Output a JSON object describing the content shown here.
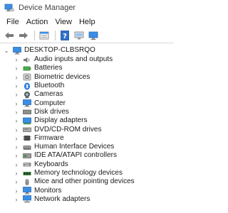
{
  "window": {
    "title": "Device Manager"
  },
  "menu": {
    "items": [
      "File",
      "Action",
      "View",
      "Help"
    ]
  },
  "toolbar": {
    "buttons": [
      "back-icon",
      "forward-icon",
      "properties-icon",
      "help-icon",
      "update-driver-icon",
      "monitor-icon"
    ]
  },
  "tree": {
    "root": {
      "label": "DESKTOP-CLBSRQO",
      "icon": "computer-icon"
    },
    "items": [
      {
        "label": "Audio inputs and outputs",
        "icon": "speaker-icon"
      },
      {
        "label": "Batteries",
        "icon": "battery-icon"
      },
      {
        "label": "Biometric devices",
        "icon": "biometric-icon"
      },
      {
        "label": "Bluetooth",
        "icon": "bluetooth-icon"
      },
      {
        "label": "Cameras",
        "icon": "camera-icon"
      },
      {
        "label": "Computer",
        "icon": "computer-icon"
      },
      {
        "label": "Disk drives",
        "icon": "disk-icon"
      },
      {
        "label": "Display adapters",
        "icon": "display-adapter-icon"
      },
      {
        "label": "DVD/CD-ROM drives",
        "icon": "dvd-icon"
      },
      {
        "label": "Firmware",
        "icon": "firmware-icon"
      },
      {
        "label": "Human Interface Devices",
        "icon": "hid-icon"
      },
      {
        "label": "IDE ATA/ATAPI controllers",
        "icon": "ide-icon"
      },
      {
        "label": "Keyboards",
        "icon": "keyboard-icon"
      },
      {
        "label": "Memory technology devices",
        "icon": "memory-icon"
      },
      {
        "label": "Mice and other pointing devices",
        "icon": "mouse-icon"
      },
      {
        "label": "Monitors",
        "icon": "monitor-icon"
      },
      {
        "label": "Network adapters",
        "icon": "network-icon"
      }
    ]
  },
  "colors": {
    "accent_blue": "#1e73d8",
    "expander": "#6a6a6a",
    "text": "#1a1a1a"
  }
}
